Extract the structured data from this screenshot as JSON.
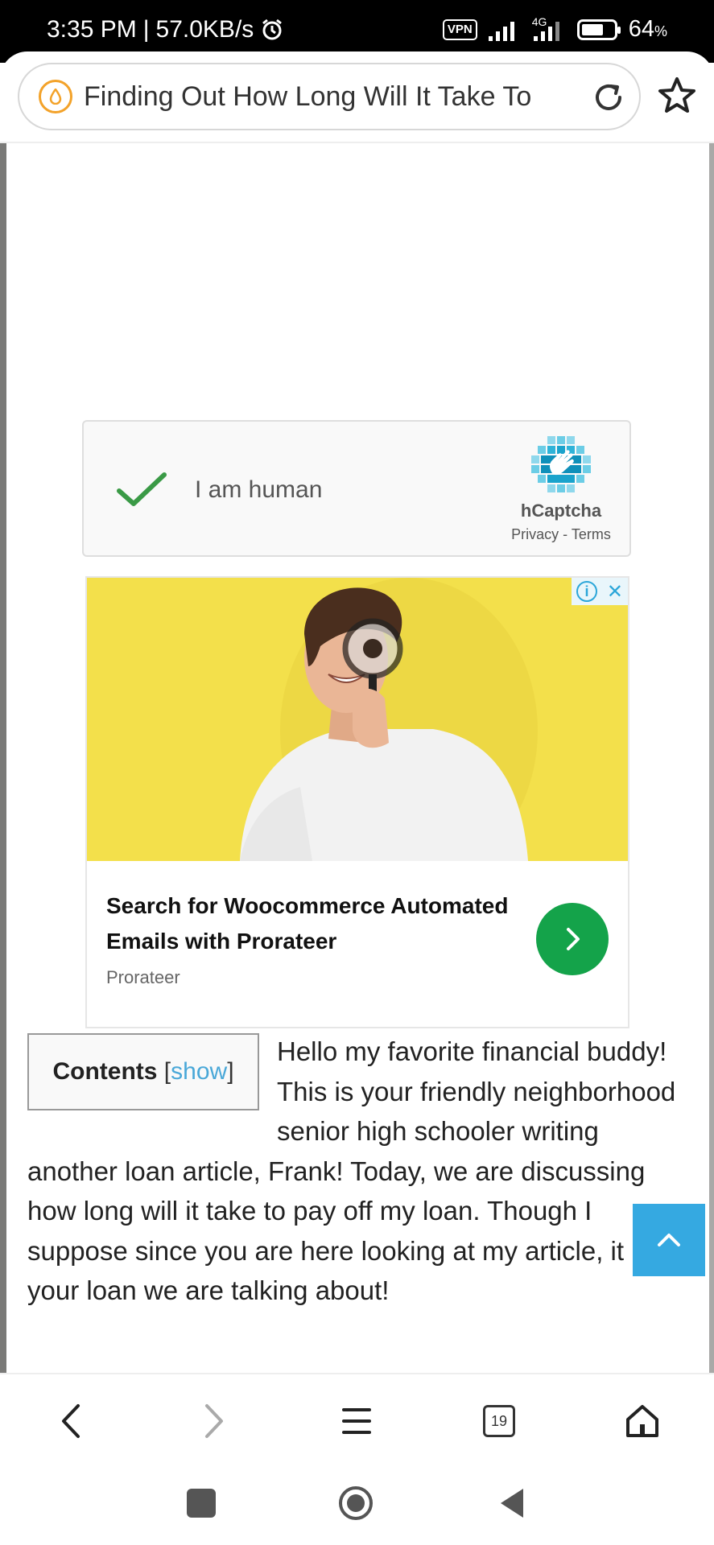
{
  "status_bar": {
    "time": "3:35 PM",
    "separator": "|",
    "speed": "57.0KB/s",
    "vpn": "VPN",
    "network": "4G",
    "battery_pct": "64",
    "battery_unit": "%"
  },
  "browser": {
    "url_title": "Finding Out How Long Will It Take To",
    "site_icon": "droplet-icon",
    "tab_count": "19"
  },
  "captcha": {
    "label": "I am human",
    "brand": "hCaptcha",
    "links": "Privacy - Terms"
  },
  "ad": {
    "title": "Search for Woocommerce Automated Emails with Prorateer",
    "source": "Prorateer",
    "info_label": "i",
    "close_label": "✕"
  },
  "toc": {
    "title": "Contents",
    "open_bracket": "[",
    "toggle": "show",
    "close_bracket": "]"
  },
  "article": {
    "paragraph": "Hello my favorite financial buddy! This is your friendly neighborhood senior high schooler writing another loan article, Frank! Today, we are discussing how long will it take to pay off my loan. Though I suppose since you are here looking at my article, it is your loan we are talking about!"
  },
  "colors": {
    "accent_blue": "#35a9e1",
    "ad_green": "#14a34a",
    "ad_yellow": "#f3e04b",
    "site_icon_orange": "#f3a229"
  }
}
